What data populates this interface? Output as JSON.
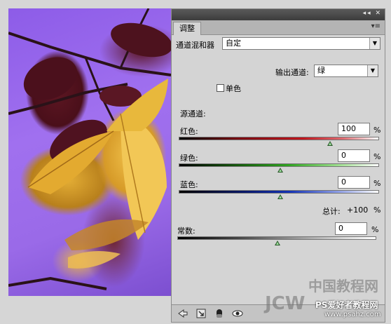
{
  "panel": {
    "tab_label": "调整",
    "menu_icon": "panel-menu-icon",
    "preset_label": "通道混和器",
    "preset_value": "自定",
    "output_channel_label": "输出通道:",
    "output_channel_value": "绿",
    "monochrome_label": "单色",
    "monochrome_checked": false,
    "source_channels_label": "源通道:",
    "red_label": "红色:",
    "red_value": "100",
    "red_level_percent_of_range": 0.86,
    "green_label": "绿色:",
    "green_value": "0",
    "blue_label": "蓝色:",
    "blue_value": "0",
    "percent_sign": "%",
    "total_label": "总计:",
    "total_value": "+100",
    "constant_label": "常数:",
    "constant_value": "0"
  },
  "watermark": {
    "line1": "中国教程网",
    "line2": "JCW",
    "line3": "PS爱好者教程网",
    "line4": "www.psahz.com"
  },
  "colors": {
    "red_track": "#c0141c",
    "green_track": "#2fa320",
    "blue_track": "#1432b4",
    "photo_bg": "#9a6ae8"
  }
}
